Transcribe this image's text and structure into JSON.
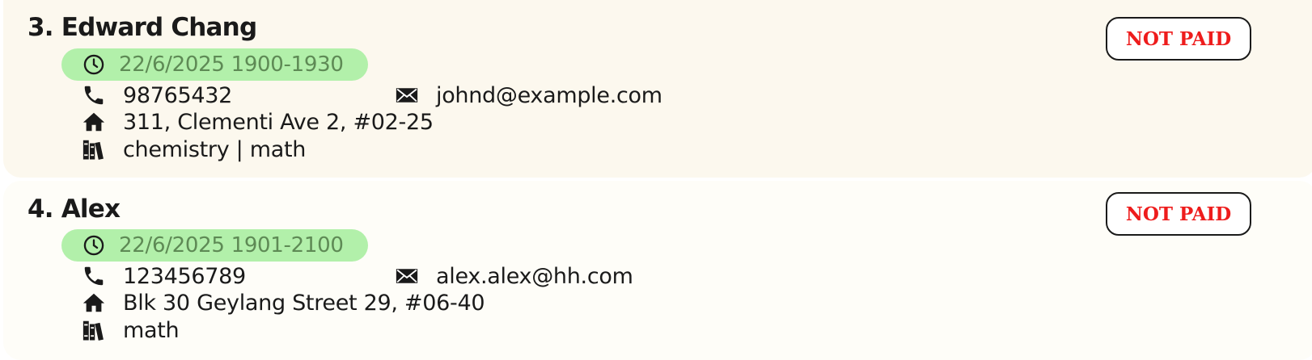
{
  "students": [
    {
      "name": "3. Edward Chang",
      "session": "22/6/2025 1900-1930",
      "phone": "98765432",
      "email": "johnd@example.com",
      "address": "311, Clementi Ave 2, #02-25",
      "subjects": "chemistry | math",
      "payment_status": "NOT PAID"
    },
    {
      "name": "4. Alex",
      "session": "22/6/2025 1901-2100",
      "phone": "123456789",
      "email": "alex.alex@hh.com",
      "address": "Blk 30 Geylang Street 29, #06-40",
      "subjects": "math",
      "payment_status": "NOT PAID"
    }
  ],
  "icons": {
    "session": "clock-icon",
    "phone": "phone-icon",
    "email": "envelope-icon",
    "address": "home-icon",
    "subjects": "books-icon"
  },
  "colors": {
    "card_1_background": "#fcf8ee",
    "card_2_background": "#fefdf8",
    "session_pill": "#b2f0aa",
    "session_text": "#5e8a55",
    "not_paid_text": "#ee1c1c"
  }
}
